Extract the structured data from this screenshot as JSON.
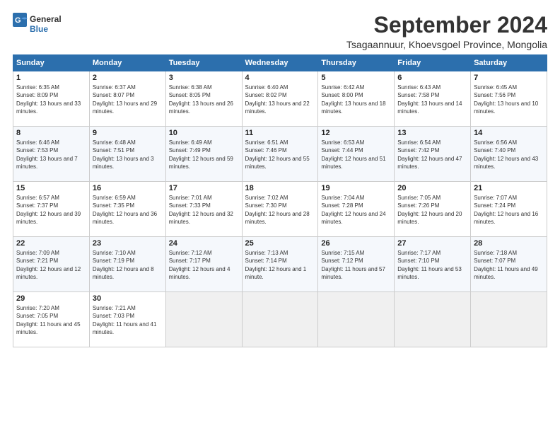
{
  "header": {
    "logo_general": "General",
    "logo_blue": "Blue",
    "month_title": "September 2024",
    "location": "Tsagaannuur, Khoevsgoel Province, Mongolia"
  },
  "weekdays": [
    "Sunday",
    "Monday",
    "Tuesday",
    "Wednesday",
    "Thursday",
    "Friday",
    "Saturday"
  ],
  "weeks": [
    [
      {
        "day": "1",
        "sunrise": "Sunrise: 6:35 AM",
        "sunset": "Sunset: 8:09 PM",
        "daylight": "Daylight: 13 hours and 33 minutes."
      },
      {
        "day": "2",
        "sunrise": "Sunrise: 6:37 AM",
        "sunset": "Sunset: 8:07 PM",
        "daylight": "Daylight: 13 hours and 29 minutes."
      },
      {
        "day": "3",
        "sunrise": "Sunrise: 6:38 AM",
        "sunset": "Sunset: 8:05 PM",
        "daylight": "Daylight: 13 hours and 26 minutes."
      },
      {
        "day": "4",
        "sunrise": "Sunrise: 6:40 AM",
        "sunset": "Sunset: 8:02 PM",
        "daylight": "Daylight: 13 hours and 22 minutes."
      },
      {
        "day": "5",
        "sunrise": "Sunrise: 6:42 AM",
        "sunset": "Sunset: 8:00 PM",
        "daylight": "Daylight: 13 hours and 18 minutes."
      },
      {
        "day": "6",
        "sunrise": "Sunrise: 6:43 AM",
        "sunset": "Sunset: 7:58 PM",
        "daylight": "Daylight: 13 hours and 14 minutes."
      },
      {
        "day": "7",
        "sunrise": "Sunrise: 6:45 AM",
        "sunset": "Sunset: 7:56 PM",
        "daylight": "Daylight: 13 hours and 10 minutes."
      }
    ],
    [
      {
        "day": "8",
        "sunrise": "Sunrise: 6:46 AM",
        "sunset": "Sunset: 7:53 PM",
        "daylight": "Daylight: 13 hours and 7 minutes."
      },
      {
        "day": "9",
        "sunrise": "Sunrise: 6:48 AM",
        "sunset": "Sunset: 7:51 PM",
        "daylight": "Daylight: 13 hours and 3 minutes."
      },
      {
        "day": "10",
        "sunrise": "Sunrise: 6:49 AM",
        "sunset": "Sunset: 7:49 PM",
        "daylight": "Daylight: 12 hours and 59 minutes."
      },
      {
        "day": "11",
        "sunrise": "Sunrise: 6:51 AM",
        "sunset": "Sunset: 7:46 PM",
        "daylight": "Daylight: 12 hours and 55 minutes."
      },
      {
        "day": "12",
        "sunrise": "Sunrise: 6:53 AM",
        "sunset": "Sunset: 7:44 PM",
        "daylight": "Daylight: 12 hours and 51 minutes."
      },
      {
        "day": "13",
        "sunrise": "Sunrise: 6:54 AM",
        "sunset": "Sunset: 7:42 PM",
        "daylight": "Daylight: 12 hours and 47 minutes."
      },
      {
        "day": "14",
        "sunrise": "Sunrise: 6:56 AM",
        "sunset": "Sunset: 7:40 PM",
        "daylight": "Daylight: 12 hours and 43 minutes."
      }
    ],
    [
      {
        "day": "15",
        "sunrise": "Sunrise: 6:57 AM",
        "sunset": "Sunset: 7:37 PM",
        "daylight": "Daylight: 12 hours and 39 minutes."
      },
      {
        "day": "16",
        "sunrise": "Sunrise: 6:59 AM",
        "sunset": "Sunset: 7:35 PM",
        "daylight": "Daylight: 12 hours and 36 minutes."
      },
      {
        "day": "17",
        "sunrise": "Sunrise: 7:01 AM",
        "sunset": "Sunset: 7:33 PM",
        "daylight": "Daylight: 12 hours and 32 minutes."
      },
      {
        "day": "18",
        "sunrise": "Sunrise: 7:02 AM",
        "sunset": "Sunset: 7:30 PM",
        "daylight": "Daylight: 12 hours and 28 minutes."
      },
      {
        "day": "19",
        "sunrise": "Sunrise: 7:04 AM",
        "sunset": "Sunset: 7:28 PM",
        "daylight": "Daylight: 12 hours and 24 minutes."
      },
      {
        "day": "20",
        "sunrise": "Sunrise: 7:05 AM",
        "sunset": "Sunset: 7:26 PM",
        "daylight": "Daylight: 12 hours and 20 minutes."
      },
      {
        "day": "21",
        "sunrise": "Sunrise: 7:07 AM",
        "sunset": "Sunset: 7:24 PM",
        "daylight": "Daylight: 12 hours and 16 minutes."
      }
    ],
    [
      {
        "day": "22",
        "sunrise": "Sunrise: 7:09 AM",
        "sunset": "Sunset: 7:21 PM",
        "daylight": "Daylight: 12 hours and 12 minutes."
      },
      {
        "day": "23",
        "sunrise": "Sunrise: 7:10 AM",
        "sunset": "Sunset: 7:19 PM",
        "daylight": "Daylight: 12 hours and 8 minutes."
      },
      {
        "day": "24",
        "sunrise": "Sunrise: 7:12 AM",
        "sunset": "Sunset: 7:17 PM",
        "daylight": "Daylight: 12 hours and 4 minutes."
      },
      {
        "day": "25",
        "sunrise": "Sunrise: 7:13 AM",
        "sunset": "Sunset: 7:14 PM",
        "daylight": "Daylight: 12 hours and 1 minute."
      },
      {
        "day": "26",
        "sunrise": "Sunrise: 7:15 AM",
        "sunset": "Sunset: 7:12 PM",
        "daylight": "Daylight: 11 hours and 57 minutes."
      },
      {
        "day": "27",
        "sunrise": "Sunrise: 7:17 AM",
        "sunset": "Sunset: 7:10 PM",
        "daylight": "Daylight: 11 hours and 53 minutes."
      },
      {
        "day": "28",
        "sunrise": "Sunrise: 7:18 AM",
        "sunset": "Sunset: 7:07 PM",
        "daylight": "Daylight: 11 hours and 49 minutes."
      }
    ],
    [
      {
        "day": "29",
        "sunrise": "Sunrise: 7:20 AM",
        "sunset": "Sunset: 7:05 PM",
        "daylight": "Daylight: 11 hours and 45 minutes."
      },
      {
        "day": "30",
        "sunrise": "Sunrise: 7:21 AM",
        "sunset": "Sunset: 7:03 PM",
        "daylight": "Daylight: 11 hours and 41 minutes."
      },
      null,
      null,
      null,
      null,
      null
    ]
  ]
}
